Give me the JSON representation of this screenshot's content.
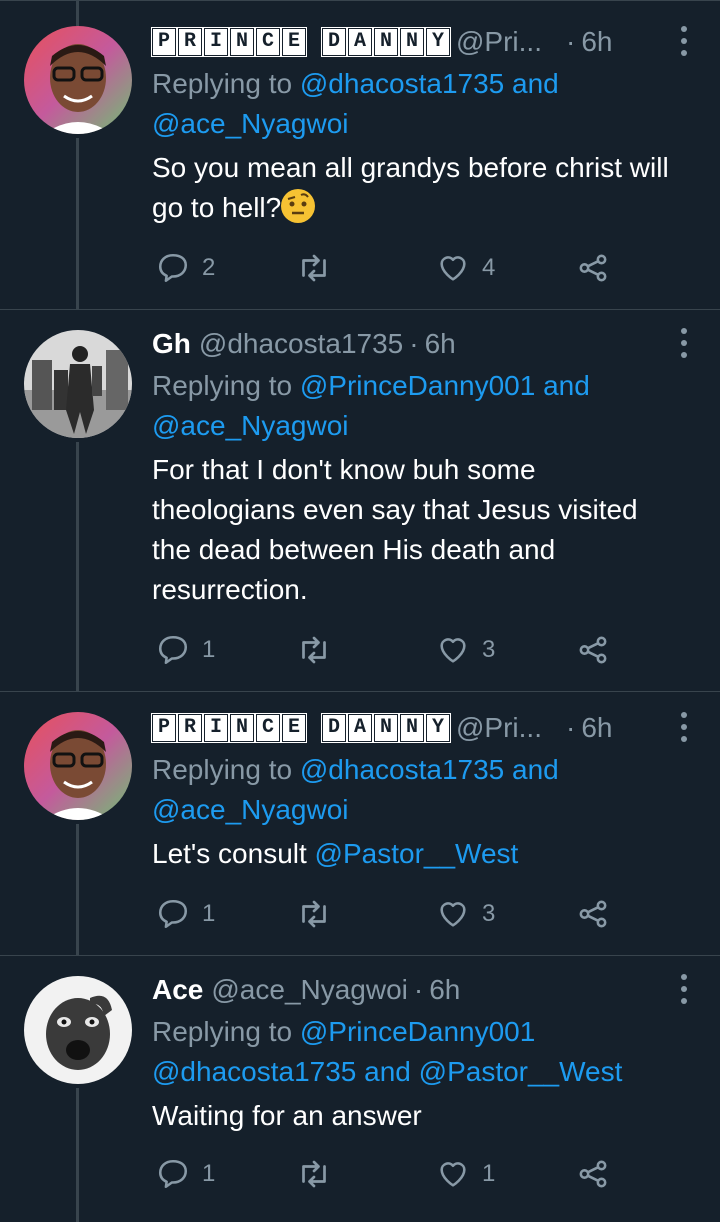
{
  "colors": {
    "background": "#15202b",
    "link": "#1d9bf0",
    "muted": "#8899a6",
    "line": "#38444d"
  },
  "tweets": [
    {
      "name_boxes": [
        "P",
        "R",
        "I",
        "N",
        "C",
        "E",
        " ",
        "D",
        "A",
        "N",
        "N",
        "Y"
      ],
      "handle": "@Pri...",
      "dot": "·",
      "time": "6h",
      "replying_prefix": "Replying to",
      "reply_to_1": "@dhacosta1735",
      "reply_and": "and",
      "reply_to_2": "@ace_Nyagwoi",
      "text": "So you mean all grandys before christ will go to hell?",
      "emoji": "face-with-raised-eyebrow",
      "replies": "2",
      "retweets": "",
      "likes": "4"
    },
    {
      "name": "Gh",
      "handle": "@dhacosta1735",
      "dot": "·",
      "time": "6h",
      "replying_prefix": "Replying to",
      "reply_to_1": "@PrinceDanny001",
      "reply_and": "and",
      "reply_to_2": "@ace_Nyagwoi",
      "text": "For that I don't know buh some theologians even say that Jesus visited the dead between His death and resurrection.",
      "replies": "1",
      "retweets": "",
      "likes": "3"
    },
    {
      "name_boxes": [
        "P",
        "R",
        "I",
        "N",
        "C",
        "E",
        " ",
        "D",
        "A",
        "N",
        "N",
        "Y"
      ],
      "handle": "@Pri...",
      "dot": "·",
      "time": "6h",
      "replying_prefix": "Replying to",
      "reply_to_1": "@dhacosta1735",
      "reply_and": "and",
      "reply_to_2": "@ace_Nyagwoi",
      "text_prefix": "Let's consult",
      "text_mention": "@Pastor__West",
      "replies": "1",
      "retweets": "",
      "likes": "3"
    },
    {
      "name": "Ace",
      "handle": "@ace_Nyagwoi",
      "dot": "·",
      "time": "6h",
      "replying_prefix": "Replying to",
      "reply_to_1": "@PrinceDanny001",
      "reply_to_2": "@dhacosta1735",
      "reply_and": "and",
      "reply_to_3": "@Pastor__West",
      "text": "Waiting for an answer",
      "replies": "1",
      "retweets": "",
      "likes": "1"
    }
  ]
}
